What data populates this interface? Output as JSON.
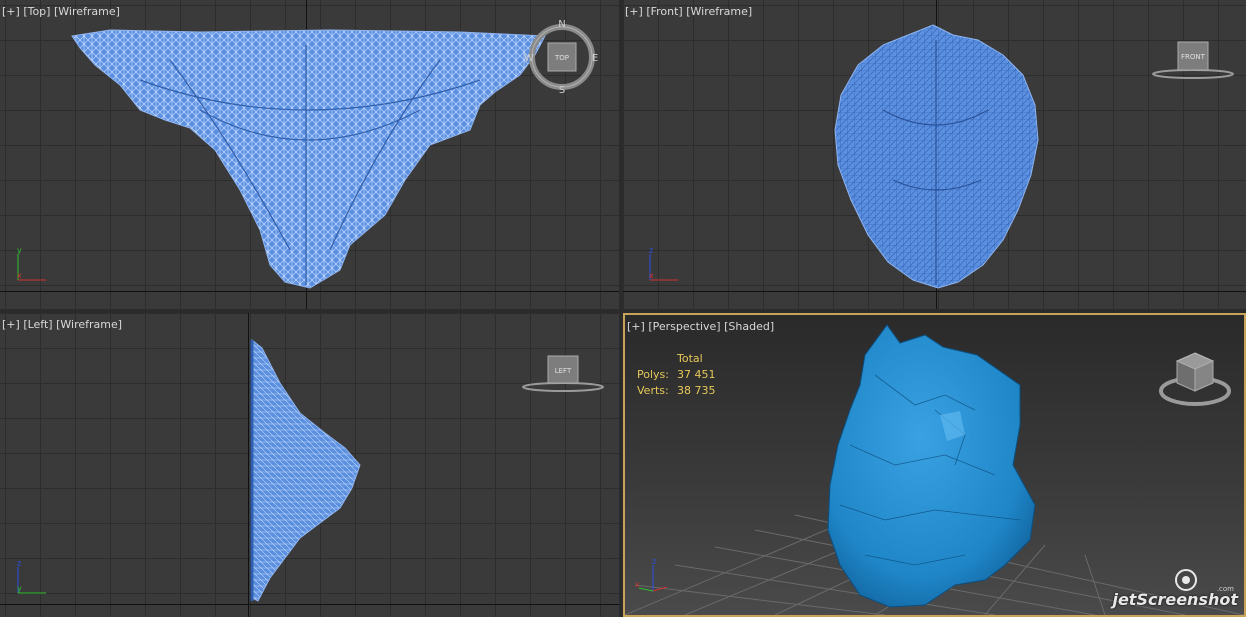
{
  "viewports": {
    "top": {
      "plus": "[+]",
      "view": "[Top]",
      "mode": "[Wireframe]",
      "cube": "TOP",
      "compass": {
        "n": "N",
        "s": "S",
        "e": "E",
        "w": "W"
      },
      "axis_v": "y",
      "axis_h": "x"
    },
    "front": {
      "plus": "[+]",
      "view": "[Front]",
      "mode": "[Wireframe]",
      "cube": "FRONT",
      "axis_v": "z",
      "axis_h": "x"
    },
    "left": {
      "plus": "[+]",
      "view": "[Left]",
      "mode": "[Wireframe]",
      "cube": "LEFT",
      "axis_v": "z",
      "axis_h": "y"
    },
    "persp": {
      "plus": "[+]",
      "view": "[Perspective]",
      "mode": "[Shaded]",
      "axis_v": "z",
      "axis_h": "x"
    }
  },
  "stats": {
    "header": "Total",
    "polys_label": "Polys:",
    "polys_value": "37 451",
    "verts_label": "Verts:",
    "verts_value": "38 735"
  },
  "watermark": {
    "brand": "jetScreenshot",
    "domain": ".com"
  },
  "colors": {
    "wireframe": "#5b8fe0",
    "wire_line": "#b9d2ff",
    "shaded": "#1f86c8",
    "active_border": "#c8a45a",
    "stats_text": "#e6c85a",
    "axis_x": "#d03030",
    "axis_y": "#30c030",
    "axis_z": "#3050e0"
  }
}
